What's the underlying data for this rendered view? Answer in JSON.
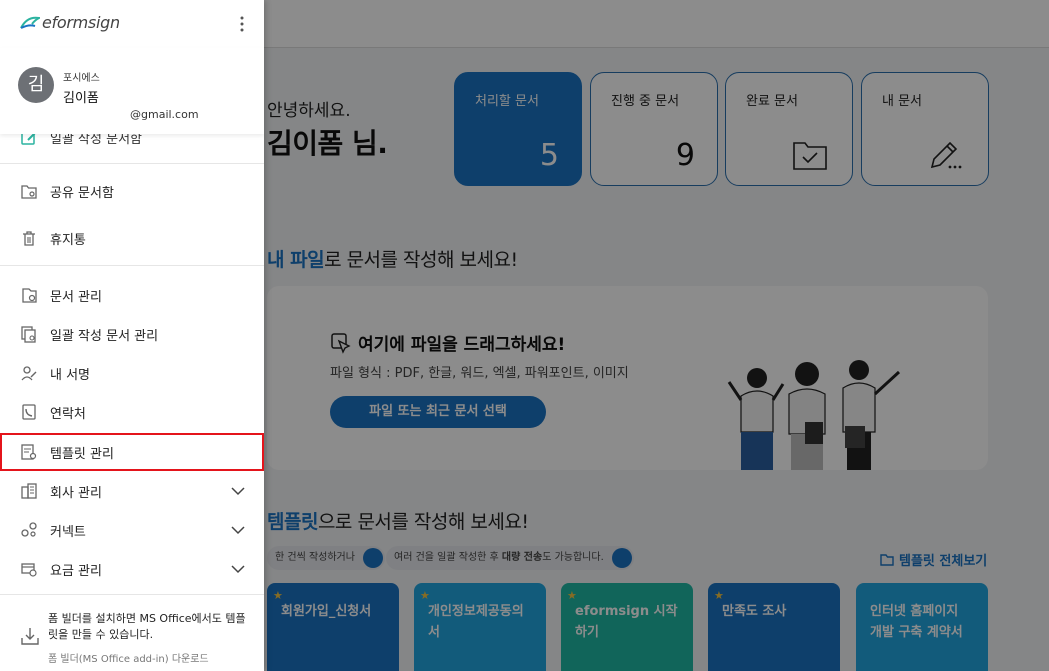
{
  "main": {
    "greeting": "안녕하세요.",
    "user_name": "김이폼 님.",
    "cards": [
      {
        "label": "처리할 문서",
        "count": "5"
      },
      {
        "label": "진행 중 문서",
        "count": "9"
      },
      {
        "label": "완료 문서",
        "icon": "folder-check-icon"
      },
      {
        "label": "내 문서",
        "icon": "pencil-icon"
      }
    ],
    "my_file_title_hl": "내 파일",
    "my_file_title_rest": "로 문서를 작성해 보세요!",
    "dropzone": {
      "title": "여기에 파일을 드래그하세요!",
      "formats": "파일 형식 : PDF, 한글, 워드, 엑셀, 파워포인트, 이미지",
      "button": "파일 또는 최근 문서 선택"
    },
    "template_title_hl": "템플릿",
    "template_title_rest": "으로 문서를 작성해 보세요!",
    "hint1": "한 건씩 작성하거나",
    "hint2_a": "여러 건을 일괄 작성한 후 ",
    "hint2_b": "대량 전송",
    "hint2_c": "도 가능합니다.",
    "view_all": "템플릿 전체보기",
    "templates": [
      {
        "name": "회원가입_신청서",
        "color": "#1b74c4"
      },
      {
        "name": "개인정보제공동의서",
        "color": "#22a6e0"
      },
      {
        "name": "eformsign 시작하기",
        "color": "#20b8a4"
      },
      {
        "name": "만족도 조사",
        "color": "#1b74c4"
      },
      {
        "name": "인터넷 홈페이지 개발 구축 계약서",
        "color": "#22a6e0"
      }
    ]
  },
  "sidebar": {
    "logo": "eformsign",
    "avatar_initial": "김",
    "company": "포시에스",
    "user_name": "김이폼",
    "email": "@gmail.com",
    "clipped_item": "일괄 작성 문서함",
    "items": [
      {
        "label": "공유 문서함",
        "icon": "shared-folder-icon"
      },
      {
        "label": "휴지통",
        "icon": "trash-icon"
      },
      {
        "label": "문서 관리",
        "icon": "document-settings-icon"
      },
      {
        "label": "일괄 작성 문서 관리",
        "icon": "bulk-document-icon"
      },
      {
        "label": "내 서명",
        "icon": "signature-icon"
      },
      {
        "label": "연락처",
        "icon": "contacts-icon"
      },
      {
        "label": "템플릿 관리",
        "icon": "template-settings-icon"
      },
      {
        "label": "회사 관리",
        "icon": "company-icon"
      },
      {
        "label": "커넥트",
        "icon": "connect-icon"
      },
      {
        "label": "요금 관리",
        "icon": "billing-icon"
      }
    ],
    "footer_text": "폼 빌더를 설치하면 MS Office에서도 템플릿을 만들 수 있습니다.",
    "footer_link": "폼 빌더(MS Office add-in) 다운로드",
    "highlight_color": "#e4141b"
  }
}
